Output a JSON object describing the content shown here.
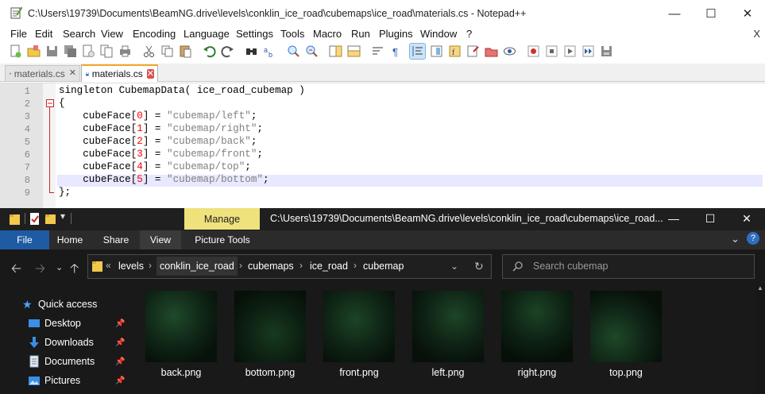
{
  "notepad": {
    "title": "C:\\Users\\19739\\Documents\\BeamNG.drive\\levels\\conklin_ice_road\\cubemaps\\ice_road\\materials.cs - Notepad++",
    "menu": [
      "File",
      "Edit",
      "Search",
      "View",
      "Encoding",
      "Language",
      "Settings",
      "Tools",
      "Macro",
      "Run",
      "Plugins",
      "Window",
      "?"
    ],
    "menu_close": "X",
    "tabs": [
      {
        "label": "materials.cs",
        "active": false
      },
      {
        "label": "materials.cs",
        "active": true
      }
    ],
    "code_lines": [
      "singleton CubemapData( ice_road_cubemap )",
      "{",
      "    cubeFace[0] = \"cubemap/left\";",
      "    cubeFace[1] = \"cubemap/right\";",
      "    cubeFace[2] = \"cubemap/back\";",
      "    cubeFace[3] = \"cubemap/front\";",
      "    cubeFace[4] = \"cubemap/top\";",
      "    cubeFace[5] = \"cubemap/bottom\";",
      "};"
    ],
    "line_numbers": [
      "1",
      "2",
      "3",
      "4",
      "5",
      "6",
      "7",
      "8",
      "9"
    ],
    "current_line": 8
  },
  "explorer": {
    "contextual_tab": "Manage",
    "title_path": "C:\\Users\\19739\\Documents\\BeamNG.drive\\levels\\conklin_ice_road\\cubemaps\\ice_road...",
    "ribbon_tabs": [
      "File",
      "Home",
      "Share",
      "View",
      "Picture Tools"
    ],
    "address": {
      "overflow": "«",
      "segments": [
        "levels",
        "conklin_ice_road",
        "cubemaps",
        "ice_road",
        "cubemap"
      ]
    },
    "search_placeholder": "Search cubemap",
    "quick_access_label": "Quick access",
    "nav_items": [
      {
        "label": "Desktop",
        "icon": "desktop-icon"
      },
      {
        "label": "Downloads",
        "icon": "downloads-icon"
      },
      {
        "label": "Documents",
        "icon": "documents-icon"
      },
      {
        "label": "Pictures",
        "icon": "pictures-icon"
      }
    ],
    "files": [
      "back.png",
      "bottom.png",
      "front.png",
      "left.png",
      "right.png",
      "top.png"
    ]
  },
  "colors": {
    "accent_blue": "#1e5ba3",
    "manage_yellow": "#efe17c",
    "npp_tab_orange": "#f5a623",
    "current_line_bg": "#e8e8ff"
  }
}
